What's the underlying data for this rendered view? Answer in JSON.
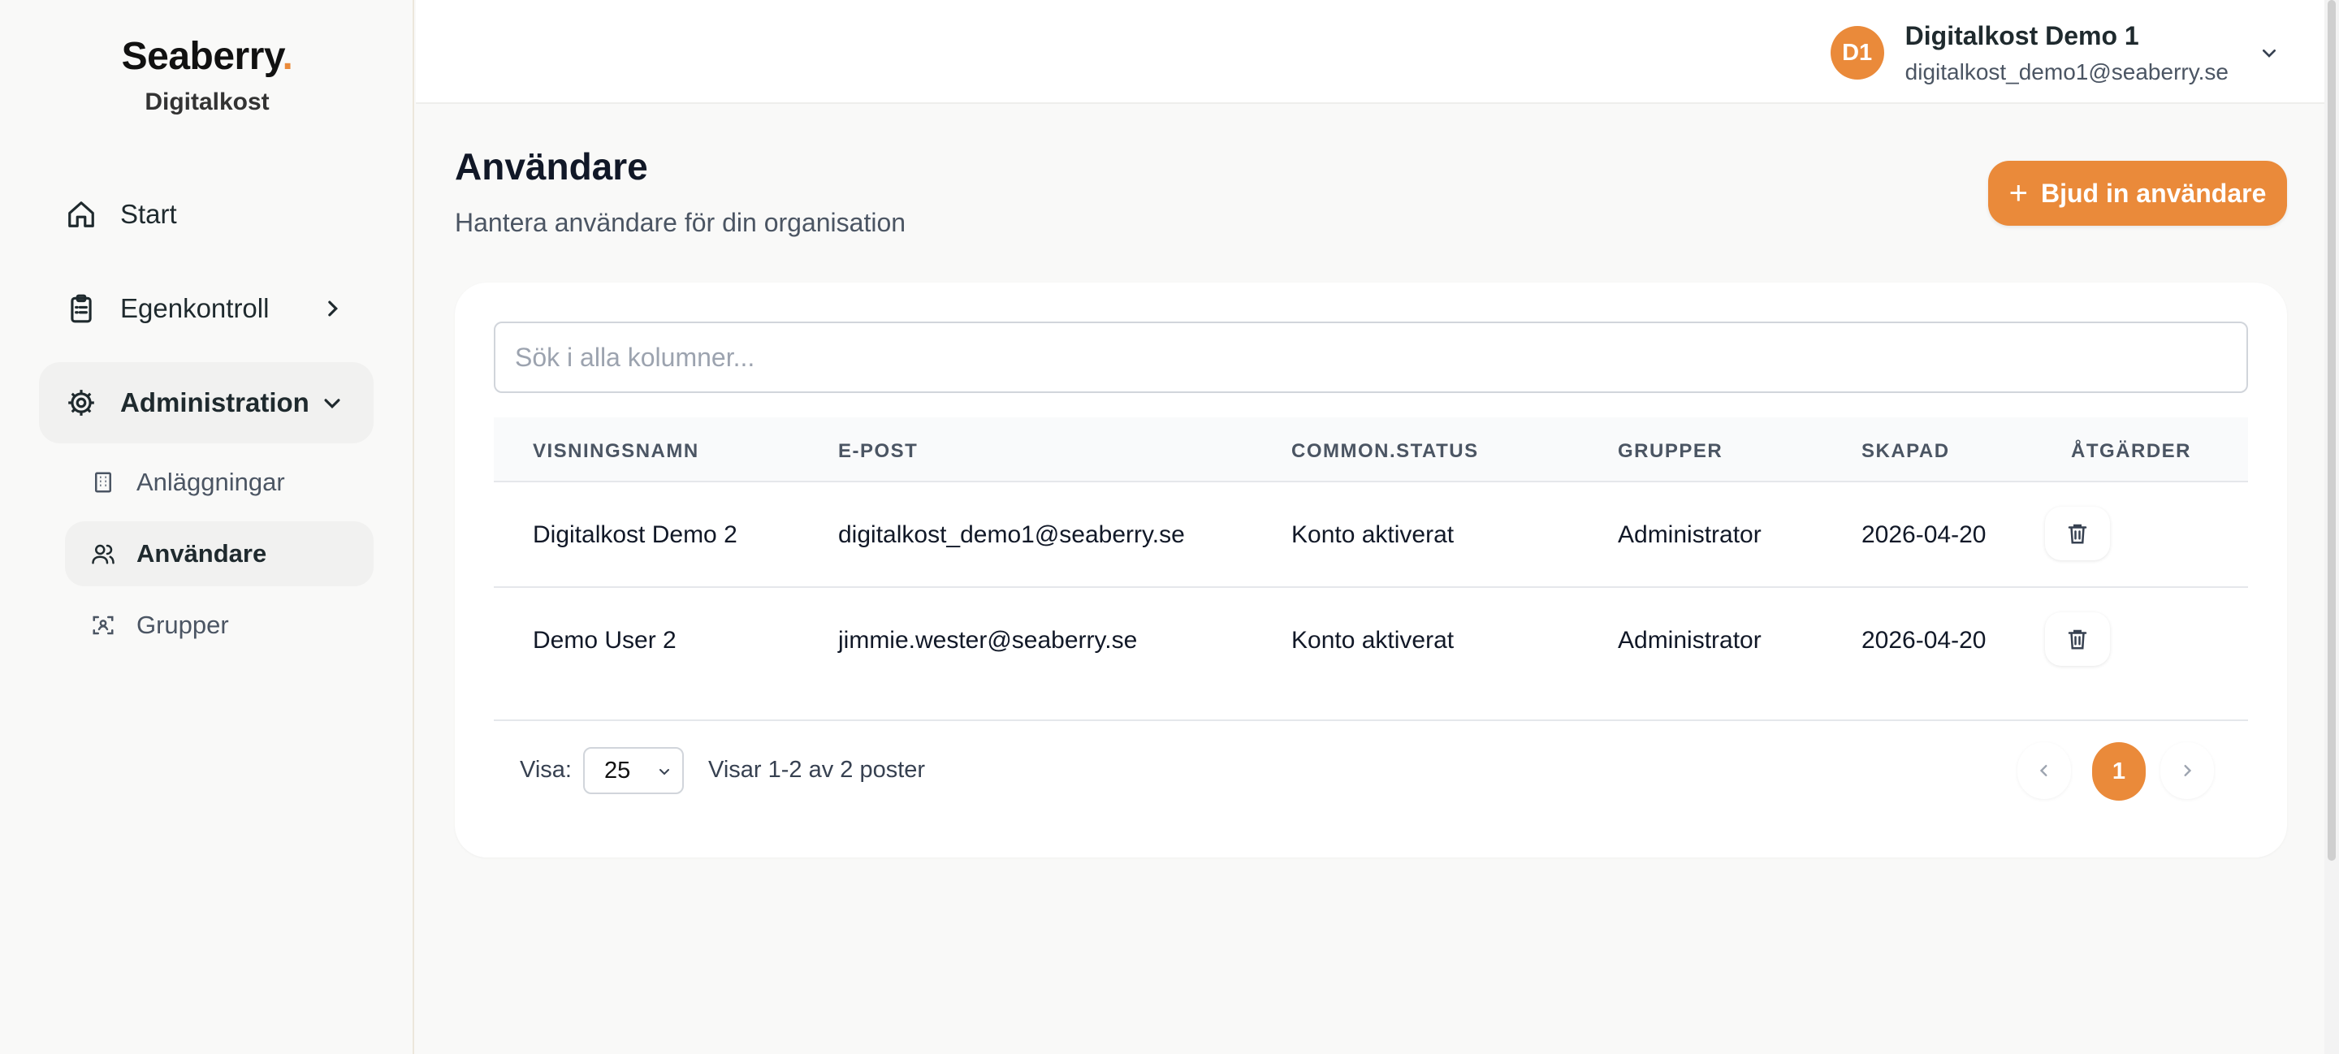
{
  "brand": {
    "logo": "Seaberry",
    "logo_dot": ".",
    "org": "Digitalkost"
  },
  "sidebar": {
    "items": [
      {
        "label": "Start",
        "icon": "home-icon"
      },
      {
        "label": "Egenkontroll",
        "icon": "clipboard-icon"
      },
      {
        "label": "Administration",
        "icon": "gear-icon"
      }
    ],
    "subitems": [
      {
        "label": "Anläggningar",
        "icon": "building-icon"
      },
      {
        "label": "Användare",
        "icon": "users-icon"
      },
      {
        "label": "Grupper",
        "icon": "group-icon"
      }
    ]
  },
  "header": {
    "avatar_initials": "D1",
    "user_name": "Digitalkost Demo 1",
    "user_email": "digitalkost_demo1@seaberry.se"
  },
  "page": {
    "title": "Användare",
    "subtitle": "Hantera användare för din organisation",
    "invite_button": "Bjud in användare"
  },
  "search": {
    "placeholder": "Sök i alla kolumner..."
  },
  "table": {
    "columns": [
      "VISNINGSNAMN",
      "E-POST",
      "COMMON.STATUS",
      "GRUPPER",
      "SKAPAD",
      "ÅTGÄRDER"
    ],
    "rows": [
      {
        "name": "Digitalkost Demo 2",
        "email": "digitalkost_demo1@seaberry.se",
        "status": "Konto aktiverat",
        "group": "Administrator",
        "created": "2026-04-20"
      },
      {
        "name": "Demo User 2",
        "email": "jimmie.wester@seaberry.se",
        "status": "Konto aktiverat",
        "group": "Administrator",
        "created": "2026-04-20"
      }
    ]
  },
  "footer": {
    "visa_label": "Visa:",
    "page_size": "25",
    "showing": "Visar 1-2 av 2 poster",
    "current_page": "1"
  },
  "colors": {
    "accent": "#ea8a3a",
    "sidebar_bg": "#f9f9f8",
    "card_bg": "#ffffff"
  }
}
